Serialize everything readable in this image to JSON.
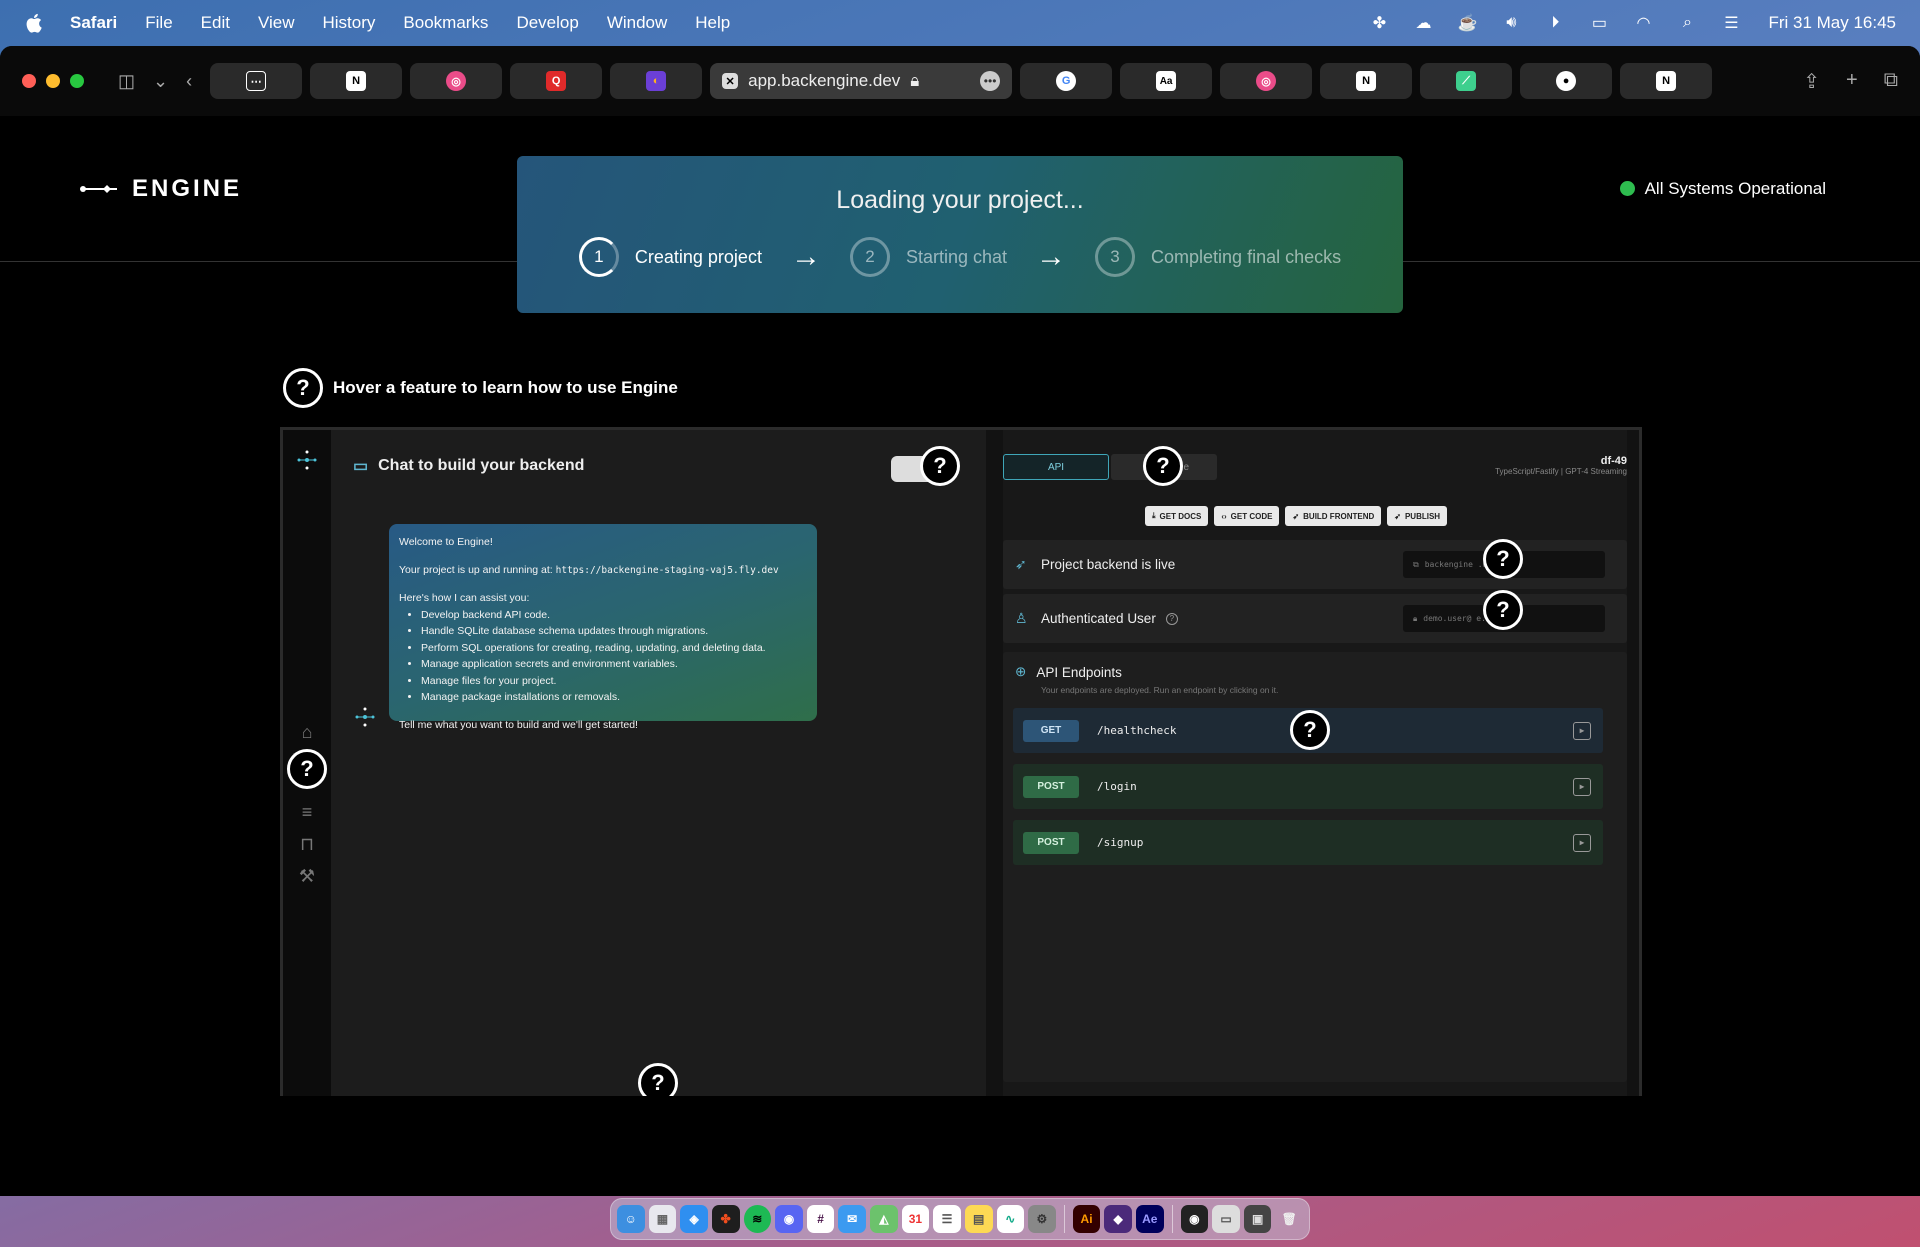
{
  "menubar": {
    "app": "Safari",
    "items": [
      "File",
      "Edit",
      "View",
      "History",
      "Bookmarks",
      "Develop",
      "Window",
      "Help"
    ],
    "clock": "Fri 31 May  16:45"
  },
  "browser": {
    "active_tab_url": "app.backengine.dev",
    "tabs_left": [
      "notion-icon",
      "dribbble-icon",
      "quora-icon",
      "arc-icon"
    ],
    "tabs_right": [
      "google-icon",
      "dictionary-icon",
      "dribbble-icon",
      "notion-icon",
      "supabase-icon",
      "github-icon",
      "notion-icon"
    ]
  },
  "site": {
    "logo_text": "ENGINE",
    "status_text": "All Systems Operational",
    "status_color": "#2ebc4f"
  },
  "loading": {
    "title": "Loading your project...",
    "steps": [
      {
        "num": "1",
        "label": "Creating project"
      },
      {
        "num": "2",
        "label": "Starting chat"
      },
      {
        "num": "3",
        "label": "Completing final checks"
      }
    ]
  },
  "hint": {
    "text": "Hover a feature to learn how to use Engine"
  },
  "chat": {
    "title": "Chat to build your backend",
    "welcome": "Welcome to Engine!",
    "running_prefix": "Your project is up and running at:",
    "running_url": "https://backengine-staging-vaj5.fly.dev",
    "assist_intro": "Here's how I can assist you:",
    "bullets": [
      "Develop backend API code.",
      "Handle SQLite database schema updates through migrations.",
      "Perform SQL operations for creating, reading, updating, and deleting data.",
      "Manage application secrets and environment variables.",
      "Manage files for your project.",
      "Manage package installations or removals."
    ],
    "closing": "Tell me what you want to build and we'll get started!"
  },
  "api": {
    "tab_active": "API",
    "tab_other": "e",
    "project_name": "df-49",
    "project_meta": "TypeScript/Fastify | GPT-4 Streaming",
    "actions": [
      "GET DOCS",
      "GET CODE",
      "BUILD FRONTEND",
      "PUBLISH"
    ],
    "backend_live": "Project backend is live",
    "backend_url": "backengine              .dev",
    "auth_user": "Authenticated User",
    "auth_value": "demo.user@              e.dev",
    "endpoints_title": "API Endpoints",
    "endpoints_sub": "Your endpoints are deployed. Run an endpoint by clicking on it.",
    "endpoints": [
      {
        "method": "GET",
        "path": "/healthcheck"
      },
      {
        "method": "POST",
        "path": "/login"
      },
      {
        "method": "POST",
        "path": "/signup"
      }
    ]
  },
  "dock": {
    "apps": [
      "Finder",
      "Launchpad",
      "Safari",
      "Figma",
      "Spotify",
      "Discord",
      "Slack",
      "Mail",
      "Maps",
      "Calendar",
      "Reminders",
      "Notes",
      "Activity",
      "Settings",
      "Ai",
      "Affinity",
      "Ae",
      "Discord",
      "Screens",
      "Preview",
      "Trash"
    ]
  }
}
